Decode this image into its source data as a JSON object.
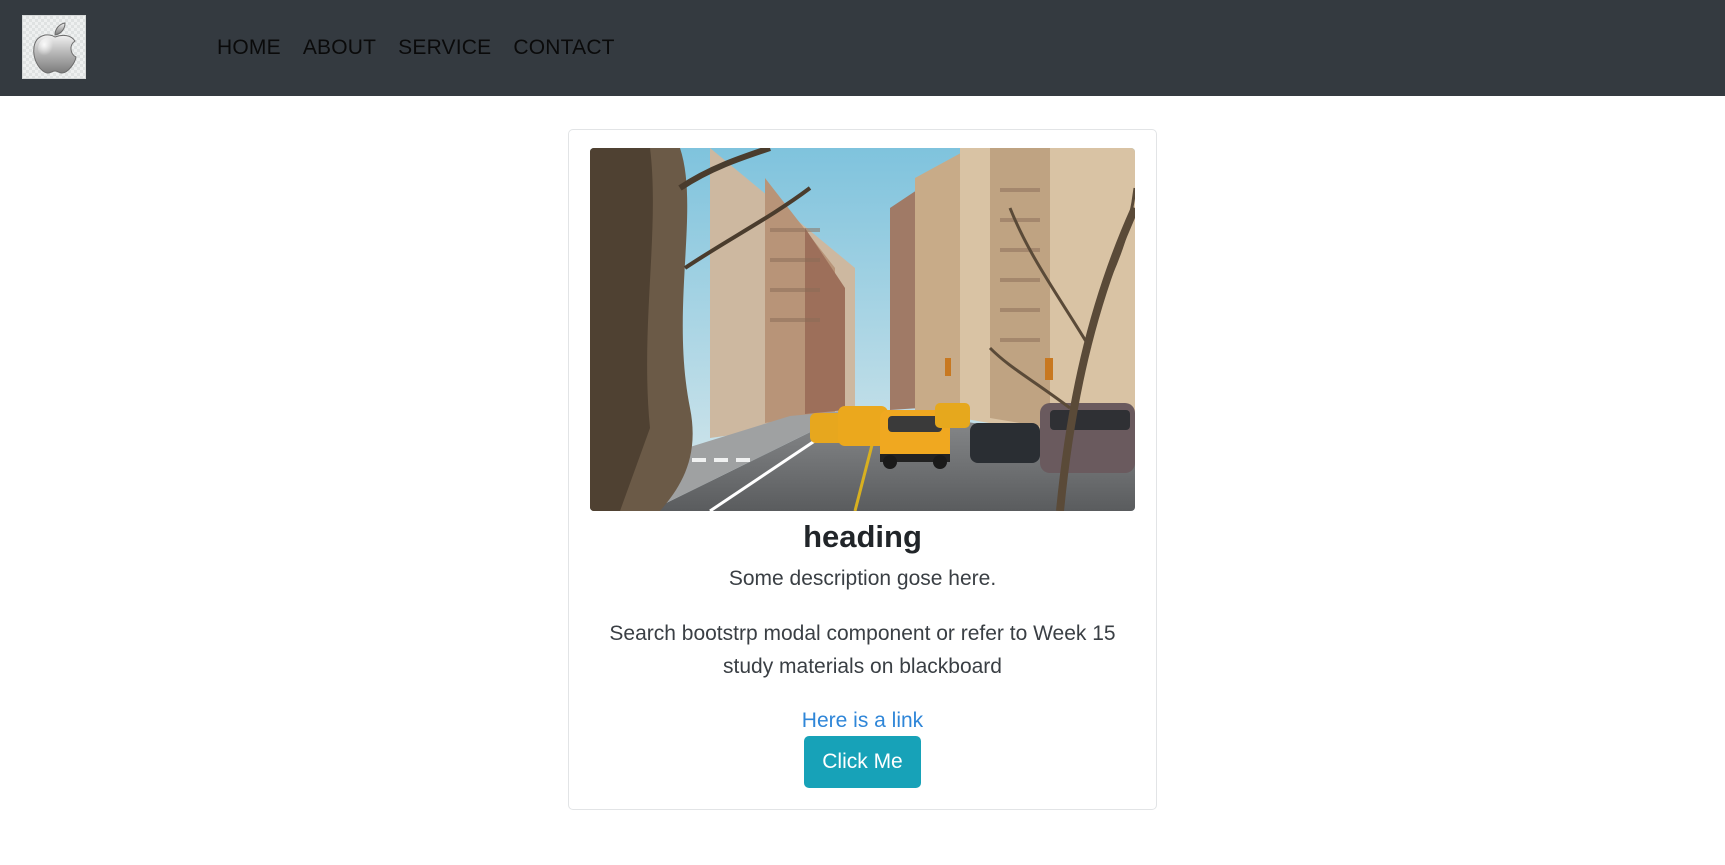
{
  "navbar": {
    "logo_icon": "apple-logo-icon",
    "links": [
      "HOME",
      "ABOUT",
      "SERVICE",
      "CONTACT"
    ]
  },
  "card": {
    "image_subject": "city-street-with-taxis",
    "title": "heading",
    "description": "Some description gose here.",
    "note": "Search bootstrp modal component or refer to Week 15 study materials on blackboard",
    "link_text": "Here is a link",
    "button_label": "Click Me"
  },
  "colors": {
    "navbar_bg": "#343a40",
    "button_bg": "#17a2b8",
    "link": "#2f86d8"
  }
}
